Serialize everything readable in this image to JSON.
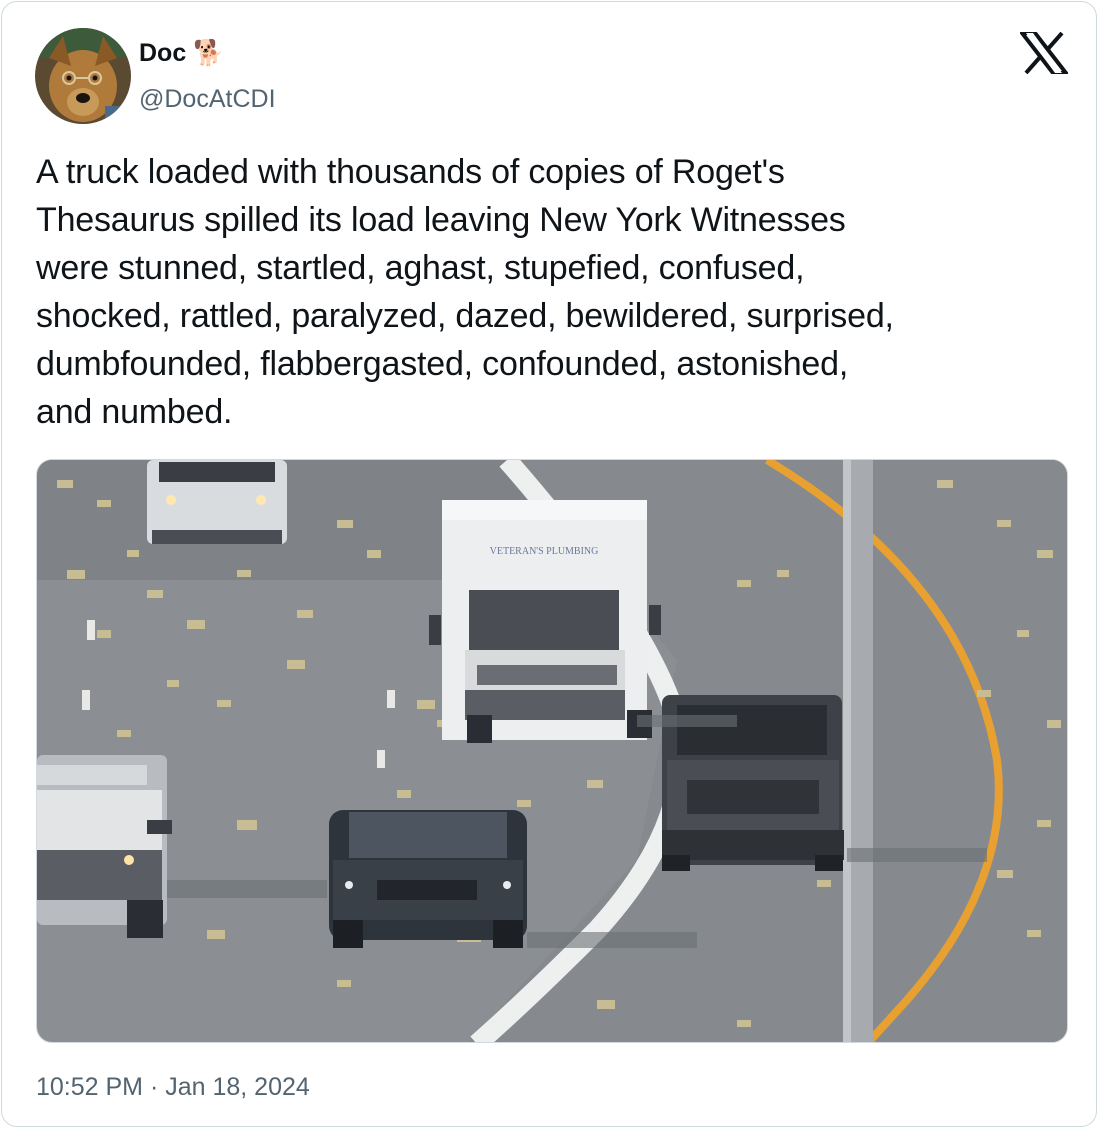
{
  "tweet": {
    "author_name": "Doc 🐕",
    "author_handle": "@DocAtCDI",
    "text": "A truck loaded with thousands of copies of Roget's\nThesaurus spilled its load leaving New York Witnesses\nwere stunned, startled, aghast, stupefied, confused,\nshocked, rattled, paralyzed, dazed, bewildered, surprised,\ndumbfounded, flabbergasted, confounded, astonished,\nand numbed.",
    "timestamp": "10:52 PM · Jan 18, 2024",
    "media": {
      "truck_sign_text": "VETERAN'S PLUMBING",
      "alt": "Traffic camera photo of a highway with books scattered across the lanes and vehicles driving through"
    }
  },
  "icons": {
    "platform_logo": "x-logo-icon",
    "avatar": "dog-avatar"
  },
  "colors": {
    "text_primary": "#0f1419",
    "text_secondary": "#536471",
    "border": "#cfd9de"
  }
}
